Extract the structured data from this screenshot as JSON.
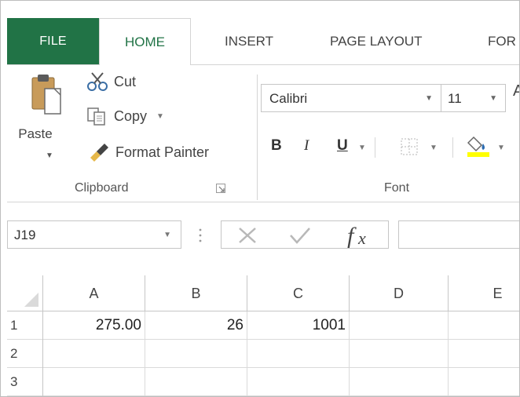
{
  "tabs": [
    {
      "label": "FILE"
    },
    {
      "label": "HOME"
    },
    {
      "label": "INSERT"
    },
    {
      "label": "PAGE LAYOUT"
    },
    {
      "label": "FOR"
    }
  ],
  "colors": {
    "file_tab": "#217346",
    "fill_color": "#ffff00",
    "grid_line": "#dadada"
  },
  "clipboard": {
    "paste_label": "Paste",
    "cut_label": "Cut",
    "copy_label": "Copy",
    "format_painter_label": "Format Painter",
    "group_label": "Clipboard"
  },
  "font": {
    "font_name": "Calibri",
    "font_size": "11",
    "grow_letter": "A",
    "bold_label": "B",
    "italic_label": "I",
    "underline_label": "U",
    "group_label": "Font"
  },
  "formula_bar": {
    "name_box": "J19",
    "formula_value": ""
  },
  "sheet": {
    "columns": [
      "A",
      "B",
      "C",
      "D",
      "E"
    ],
    "rows": [
      {
        "number": "1",
        "cells": [
          "275.00",
          "26",
          "1001",
          "",
          ""
        ]
      },
      {
        "number": "2",
        "cells": [
          "",
          "",
          "",
          "",
          ""
        ]
      },
      {
        "number": "3",
        "cells": [
          "",
          "",
          "",
          "",
          ""
        ]
      }
    ]
  }
}
